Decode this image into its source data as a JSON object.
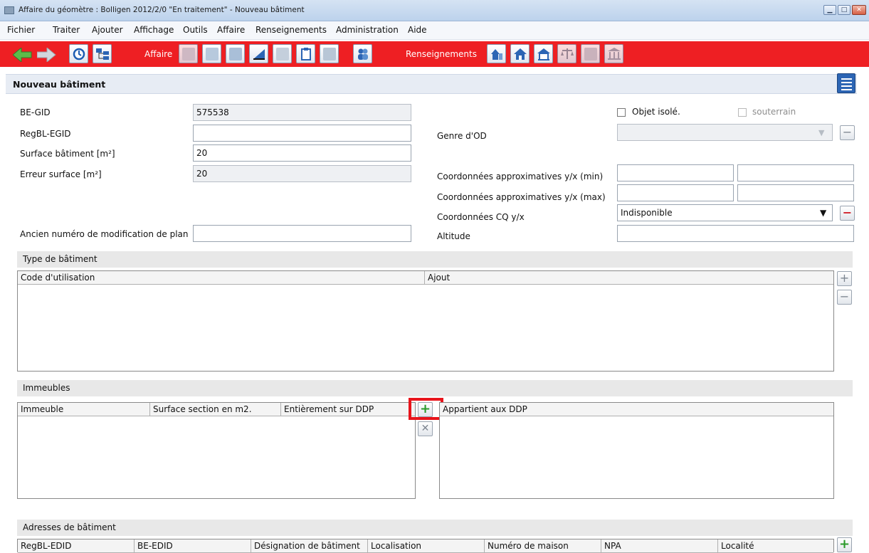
{
  "window": {
    "title": "Affaire du géomètre : Bolligen 2012/2/0 \"En traitement\"  - Nouveau bâtiment",
    "min_glyph": "▁",
    "max_glyph": "□",
    "close_glyph": "✕"
  },
  "menu": [
    "Fichier",
    "Traiter",
    "Ajouter",
    "Affichage",
    "Outils",
    "Affaire",
    "Renseignements",
    "Administration",
    "Aide"
  ],
  "toolbar": {
    "affaire_label": "Affaire",
    "renseignements_label": "Renseignements"
  },
  "panel": {
    "title": "Nouveau bâtiment"
  },
  "form": {
    "be_gid_label": "BE-GID",
    "be_gid_value": "575538",
    "regbl_egid_label": "RegBL-EGID",
    "regbl_egid_value": "",
    "surface_label": "Surface bâtiment [m²]",
    "surface_value": "20",
    "erreur_label": "Erreur surface [m²]",
    "erreur_value": "20",
    "ancien_label": "Ancien numéro de modification de plan",
    "ancien_value": "",
    "objet_isole_label": "Objet isolé.",
    "souterrain_label": "souterrain",
    "genre_od_label": "Genre d'OD",
    "genre_od_value": "",
    "coord_min_label": "Coordonnées approximatives y/x (min)",
    "coord_max_label": "Coordonnées approximatives y/x (max)",
    "coord_cq_label": "Coordonnées CQ y/x",
    "coord_cq_value": "Indisponible",
    "altitude_label": "Altitude",
    "altitude_value": ""
  },
  "type_batiment": {
    "title": "Type de bâtiment",
    "columns": [
      "Code d'utilisation",
      "Ajout"
    ]
  },
  "immeubles": {
    "title": "Immeubles",
    "columns": [
      "Immeuble",
      "Surface section en m2.",
      "Entièrement sur DDP"
    ],
    "ddp_column": "Appartient aux DDP"
  },
  "adresses": {
    "title": "Adresses de bâtiment",
    "columns": [
      "RegBL-EDID",
      "BE-EDID",
      "Désignation de bâtiment",
      "Localisation",
      "Numéro de maison",
      "NPA",
      "Localité"
    ]
  },
  "glyphs": {
    "plus": "+",
    "minus": "−",
    "cross": "✕",
    "dropdown": "▼"
  },
  "colors": {
    "toolbar_red": "#ee1f23",
    "highlight_red": "#e8141b",
    "add_green": "#2a9a2a"
  }
}
